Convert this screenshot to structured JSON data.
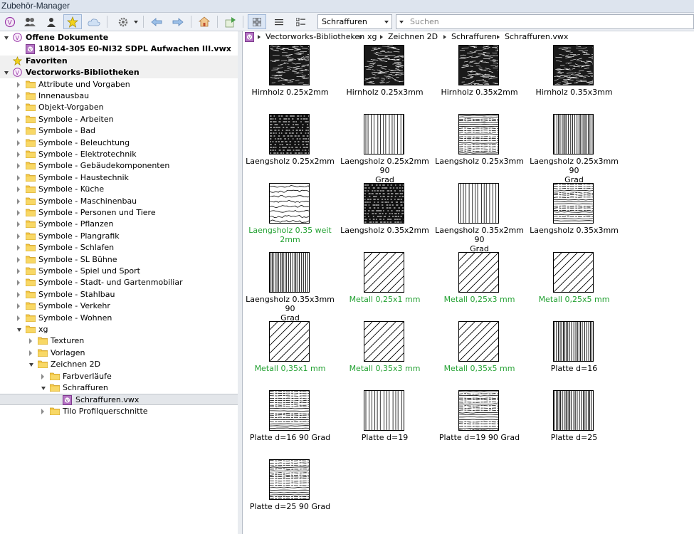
{
  "window": {
    "title": "Zubehör-Manager"
  },
  "toolbar": {
    "filter_value": "Schraffuren",
    "search_placeholder": "Suchen",
    "buttons": [
      "vectorworks-logo-icon",
      "users-icon",
      "user-icon",
      "star-icon",
      "cloud-icon",
      "gear-icon",
      "arrow-left-icon",
      "arrow-right-icon",
      "home-icon",
      "export-icon",
      "grid-view-icon",
      "list-view-icon",
      "detail-view-icon"
    ]
  },
  "tree": {
    "open_docs_header": "Offene Dokumente",
    "open_doc_file": "18014-305 E0-NI32 SDPL Aufwachen III.vwx",
    "favorites_header": "Favoriten",
    "libraries_header": "Vectorworks-Bibliotheken",
    "folders": [
      "Attribute und Vorgaben",
      "Innenausbau",
      "Objekt-Vorgaben",
      "Symbole - Arbeiten",
      "Symbole - Bad",
      "Symbole - Beleuchtung",
      "Symbole - Elektrotechnik",
      "Symbole - Gebäudekomponenten",
      "Symbole - Haustechnik",
      "Symbole - Küche",
      "Symbole - Maschinenbau",
      "Symbole - Personen und Tiere",
      "Symbole - Pflanzen",
      "Symbole - Plangrafik",
      "Symbole - Schlafen",
      "Symbole - SL Bühne",
      "Symbole - Spiel und Sport",
      "Symbole - Stadt- und Gartenmobiliar",
      "Symbole - Stahlbau",
      "Symbole - Verkehr",
      "Symbole - Wohnen"
    ],
    "xg": "xg",
    "xg_children": [
      "Texturen",
      "Vorlagen",
      "Zeichnen 2D"
    ],
    "z2d_children": [
      "Farbverläufe",
      "Schraffuren"
    ],
    "selected_file": "Schraffuren.vwx",
    "last_folder": "Tilo Profilquerschnitte"
  },
  "breadcrumb": [
    "Vectorworks-Bibliotheken",
    "xg",
    "Zeichnen 2D",
    "Schraffuren",
    "Schraffuren.vwx"
  ],
  "items": [
    {
      "l1": "Hirnholz 0.25x2mm",
      "l2": "",
      "pattern": "dense",
      "green": false
    },
    {
      "l1": "Hirnholz 0.25x3mm",
      "l2": "",
      "pattern": "dense",
      "green": false
    },
    {
      "l1": "Hirnholz 0.35x2mm",
      "l2": "",
      "pattern": "dense",
      "green": false
    },
    {
      "l1": "Hirnholz 0.35x3mm",
      "l2": "",
      "pattern": "dense",
      "green": false
    },
    {
      "l1": "Laengsholz 0.25x2mm",
      "l2": "",
      "pattern": "hdense",
      "green": false
    },
    {
      "l1": "Laengsholz 0.25x2mm 90",
      "l2": "Grad",
      "pattern": "vert",
      "green": false
    },
    {
      "l1": "Laengsholz 0.25x3mm",
      "l2": "",
      "pattern": "hwave",
      "green": false
    },
    {
      "l1": "Laengsholz 0.25x3mm 90",
      "l2": "Grad",
      "pattern": "vdense",
      "green": false
    },
    {
      "l1": "Laengsholz 0.35 weit 2mm",
      "l2": "",
      "pattern": "wave",
      "green": true
    },
    {
      "l1": "Laengsholz 0.35x2mm",
      "l2": "",
      "pattern": "hdense",
      "green": false
    },
    {
      "l1": "Laengsholz 0.35x2mm 90",
      "l2": "Grad",
      "pattern": "vert",
      "green": false
    },
    {
      "l1": "Laengsholz 0.35x3mm",
      "l2": "",
      "pattern": "hwave",
      "green": false
    },
    {
      "l1": "Laengsholz 0.35x3mm 90",
      "l2": "Grad",
      "pattern": "vdense",
      "green": false
    },
    {
      "l1": "Metall 0,25x1 mm",
      "l2": "",
      "pattern": "diag",
      "green": true
    },
    {
      "l1": "Metall 0,25x3 mm",
      "l2": "",
      "pattern": "diag",
      "green": true
    },
    {
      "l1": "Metall 0,25x5 mm",
      "l2": "",
      "pattern": "diag",
      "green": true
    },
    {
      "l1": "Metall 0,35x1 mm",
      "l2": "",
      "pattern": "diag",
      "green": true
    },
    {
      "l1": "Metall 0,35x3 mm",
      "l2": "",
      "pattern": "diag",
      "green": true
    },
    {
      "l1": "Metall 0,35x5 mm",
      "l2": "",
      "pattern": "diag",
      "green": true
    },
    {
      "l1": "Platte d=16",
      "l2": "",
      "pattern": "vdense",
      "green": false
    },
    {
      "l1": "Platte d=16 90 Grad",
      "l2": "",
      "pattern": "hwave",
      "green": false
    },
    {
      "l1": "Platte d=19",
      "l2": "",
      "pattern": "vert",
      "green": false
    },
    {
      "l1": "Platte d=19 90 Grad",
      "l2": "",
      "pattern": "hwave",
      "green": false
    },
    {
      "l1": "Platte d=25",
      "l2": "",
      "pattern": "vdense",
      "green": false
    },
    {
      "l1": "Platte d=25 90 Grad",
      "l2": "",
      "pattern": "hwave",
      "green": false
    }
  ]
}
